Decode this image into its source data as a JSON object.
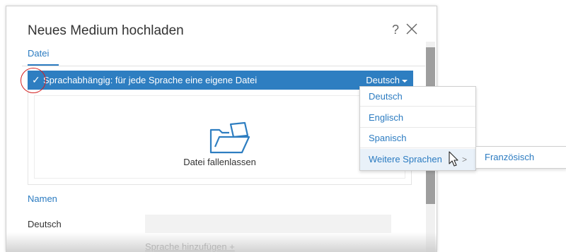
{
  "dialog": {
    "title": "Neues Medium hochladen",
    "help_label": "?",
    "close_icon": "close-icon",
    "tab": "Datei"
  },
  "language_bar": {
    "checkbox_state": "checked",
    "label": "Sprachabhängig: für jede Sprache eine eigene Datei",
    "selected_language": "Deutsch"
  },
  "drop_zone": {
    "icon": "folder-open-icon",
    "label": "Datei fallenlassen"
  },
  "names": {
    "section_title": "Namen",
    "rows": [
      {
        "language": "Deutsch",
        "value": ""
      }
    ],
    "add_language": "Sprache hinzufügen +"
  },
  "language_dropdown": {
    "items": [
      "Deutsch",
      "Englisch",
      "Spanisch",
      "Weitere Sprachen"
    ],
    "active_item": "Weitere Sprachen",
    "submenu_items": [
      "Französisch"
    ]
  },
  "colors": {
    "accent": "#2e7ec1",
    "link": "#2b7bc1",
    "annotation_circle": "#d32020"
  }
}
